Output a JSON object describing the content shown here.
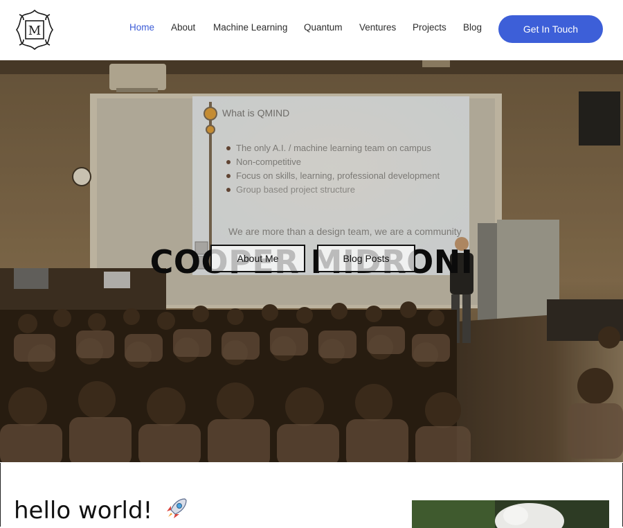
{
  "brand": {
    "logo_letter": "M"
  },
  "nav": {
    "items": [
      {
        "label": "Home",
        "active": true
      },
      {
        "label": "About",
        "active": false
      },
      {
        "label": "Machine Learning",
        "active": false
      },
      {
        "label": "Quantum",
        "active": false
      },
      {
        "label": "Ventures",
        "active": false
      },
      {
        "label": "Projects",
        "active": false
      },
      {
        "label": "Blog",
        "active": false
      }
    ],
    "cta_label": "Get In Touch"
  },
  "hero": {
    "title": "COOPER MIDRONI",
    "buttons": {
      "about": "About Me",
      "blog": "Blog Posts"
    },
    "slide": {
      "title": "What is QMIND",
      "bullets": [
        "The only A.I. / machine learning team on campus",
        "Non-competitive",
        "Focus on skills, learning, professional development",
        "Group based project structure"
      ],
      "tagline": "We are more than a design team, we are a community"
    }
  },
  "intro": {
    "heading": "hello world!"
  },
  "colors": {
    "accent": "#3d5fd8",
    "text": "#111111",
    "nav_active": "#3b5bd6"
  }
}
